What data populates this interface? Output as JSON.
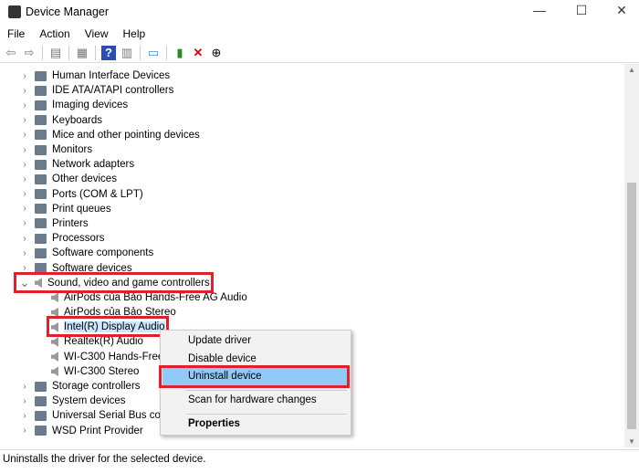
{
  "window": {
    "title": "Device Manager",
    "minimize": "—",
    "maximize": "☐",
    "close": "✕"
  },
  "menu": [
    "File",
    "Action",
    "View",
    "Help"
  ],
  "toolbar": [
    "back-icon",
    "forward-icon",
    "show-hide-console-tree-icon",
    "properties-icon",
    "help-icon",
    "action-pane-icon",
    "scan-hardware-icon",
    "update-driver-icon",
    "uninstall-icon",
    "disable-icon"
  ],
  "tree": [
    {
      "label": "Human Interface Devices"
    },
    {
      "label": "IDE ATA/ATAPI controllers"
    },
    {
      "label": "Imaging devices"
    },
    {
      "label": "Keyboards"
    },
    {
      "label": "Mice and other pointing devices"
    },
    {
      "label": "Monitors"
    },
    {
      "label": "Network adapters"
    },
    {
      "label": "Other devices"
    },
    {
      "label": "Ports (COM & LPT)"
    },
    {
      "label": "Print queues"
    },
    {
      "label": "Printers"
    },
    {
      "label": "Processors"
    },
    {
      "label": "Software components"
    },
    {
      "label": "Software devices"
    },
    {
      "label": "Sound, video and game controllers",
      "expanded": true,
      "children": [
        "AirPods của Bảo Hands-Free AG Audio",
        "AirPods của Bảo Stereo",
        "Intel(R) Display Audio",
        "Realtek(R) Audio",
        "WI-C300 Hands-Free AG Audio",
        "WI-C300 Stereo"
      ]
    },
    {
      "label": "Storage controllers"
    },
    {
      "label": "System devices"
    },
    {
      "label": "Universal Serial Bus controllers"
    },
    {
      "label": "WSD Print Provider"
    }
  ],
  "selected_device": "Intel(R) Display Audio",
  "context_menu": {
    "items": [
      "Update driver",
      "Disable device",
      "Uninstall device",
      "Scan for hardware changes",
      "Properties"
    ],
    "highlighted": "Uninstall device"
  },
  "status": "Uninstalls the driver for the selected device.",
  "colors": {
    "highlight_box": "#e0202a",
    "menu_hover": "#91c9f7",
    "selection": "#cce8ff"
  }
}
